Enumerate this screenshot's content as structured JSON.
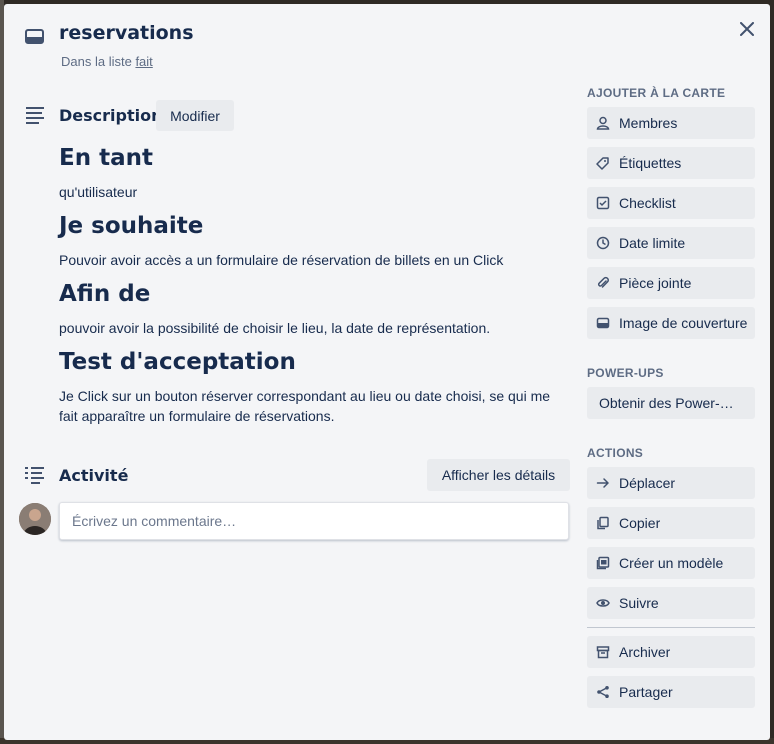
{
  "card": {
    "title": "reservations",
    "list_prefix": "Dans la liste",
    "list_name": "fait"
  },
  "description": {
    "heading": "Description",
    "edit_label": "Modifier",
    "blocks": [
      {
        "heading": "En tant",
        "text": "qu'utilisateur"
      },
      {
        "heading": "Je souhaite",
        "text": "Pouvoir avoir accès a un formulaire de réservation de billets en un Click"
      },
      {
        "heading": "Afin de",
        "text": "pouvoir avoir la possibilité de choisir le lieu, la date de représentation."
      },
      {
        "heading": "Test d'acceptation",
        "text": "Je Click sur un bouton réserver correspondant au lieu ou date choisi, se qui me fait apparaître un formulaire de réservations."
      }
    ]
  },
  "activity": {
    "heading": "Activité",
    "details_label": "Afficher les détails",
    "comment_placeholder": "Écrivez un commentaire…"
  },
  "sidebar": {
    "add_heading": "AJOUTER À LA CARTE",
    "add_items": [
      {
        "label": "Membres",
        "icon": "person-icon"
      },
      {
        "label": "Étiquettes",
        "icon": "label-icon"
      },
      {
        "label": "Checklist",
        "icon": "checklist-icon"
      },
      {
        "label": "Date limite",
        "icon": "clock-icon"
      },
      {
        "label": "Pièce jointe",
        "icon": "paperclip-icon"
      },
      {
        "label": "Image de couverture",
        "icon": "cover-icon"
      }
    ],
    "powerups_heading": "POWER-UPS",
    "powerups_label": "Obtenir des Power-Ups",
    "actions_heading": "ACTIONS",
    "action_items": [
      {
        "label": "Déplacer",
        "icon": "arrow-right-icon"
      },
      {
        "label": "Copier",
        "icon": "copy-icon"
      },
      {
        "label": "Créer un modèle",
        "icon": "template-icon"
      },
      {
        "label": "Suivre",
        "icon": "eye-icon"
      }
    ],
    "extra_actions": [
      {
        "label": "Archiver",
        "icon": "archive-icon"
      },
      {
        "label": "Partager",
        "icon": "share-icon"
      }
    ]
  }
}
